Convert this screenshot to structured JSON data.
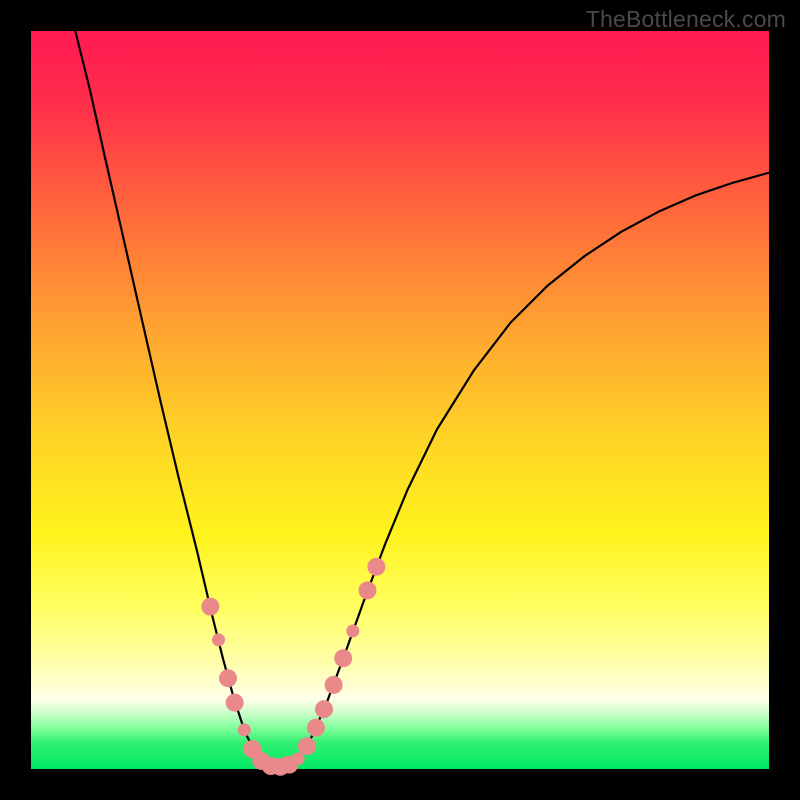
{
  "watermark": "TheBottleneck.com",
  "chart_data": {
    "type": "line",
    "title": "",
    "xlabel": "",
    "ylabel": "",
    "xlim": [
      0,
      100
    ],
    "ylim": [
      0,
      100
    ],
    "gradient": {
      "stops": [
        {
          "pos": 0.0,
          "color": "#ff1a52"
        },
        {
          "pos": 0.1,
          "color": "#ff2e4a"
        },
        {
          "pos": 0.25,
          "color": "#ff6a3a"
        },
        {
          "pos": 0.4,
          "color": "#ffa231"
        },
        {
          "pos": 0.55,
          "color": "#ffd326"
        },
        {
          "pos": 0.68,
          "color": "#fff31c"
        },
        {
          "pos": 0.78,
          "color": "#ffff60"
        },
        {
          "pos": 0.86,
          "color": "#ffffb0"
        },
        {
          "pos": 0.905,
          "color": "#ffffe8"
        },
        {
          "pos": 0.925,
          "color": "#c8ffc8"
        },
        {
          "pos": 0.945,
          "color": "#80ff9a"
        },
        {
          "pos": 0.965,
          "color": "#30f070"
        },
        {
          "pos": 1.0,
          "color": "#00e865"
        }
      ]
    },
    "series": [
      {
        "name": "bottleneck-curve",
        "color": "#000000",
        "width": 2.2,
        "points": [
          {
            "x": 6.0,
            "y": 100.0
          },
          {
            "x": 8.0,
            "y": 92.0
          },
          {
            "x": 10.0,
            "y": 83.0
          },
          {
            "x": 12.5,
            "y": 72.0
          },
          {
            "x": 15.0,
            "y": 61.0
          },
          {
            "x": 17.5,
            "y": 50.0
          },
          {
            "x": 20.0,
            "y": 39.5
          },
          {
            "x": 22.5,
            "y": 29.5
          },
          {
            "x": 24.5,
            "y": 21.0
          },
          {
            "x": 26.0,
            "y": 15.0
          },
          {
            "x": 27.5,
            "y": 9.5
          },
          {
            "x": 29.0,
            "y": 5.0
          },
          {
            "x": 30.5,
            "y": 2.0
          },
          {
            "x": 32.0,
            "y": 0.6
          },
          {
            "x": 33.5,
            "y": 0.2
          },
          {
            "x": 35.0,
            "y": 0.5
          },
          {
            "x": 36.5,
            "y": 1.8
          },
          {
            "x": 38.0,
            "y": 4.3
          },
          {
            "x": 40.0,
            "y": 8.8
          },
          {
            "x": 42.5,
            "y": 15.5
          },
          {
            "x": 45.0,
            "y": 22.5
          },
          {
            "x": 48.0,
            "y": 30.5
          },
          {
            "x": 51.0,
            "y": 37.8
          },
          {
            "x": 55.0,
            "y": 46.0
          },
          {
            "x": 60.0,
            "y": 54.0
          },
          {
            "x": 65.0,
            "y": 60.5
          },
          {
            "x": 70.0,
            "y": 65.5
          },
          {
            "x": 75.0,
            "y": 69.5
          },
          {
            "x": 80.0,
            "y": 72.8
          },
          {
            "x": 85.0,
            "y": 75.5
          },
          {
            "x": 90.0,
            "y": 77.7
          },
          {
            "x": 95.0,
            "y": 79.4
          },
          {
            "x": 100.0,
            "y": 80.8
          }
        ]
      }
    ],
    "markers": {
      "color": "#e98989",
      "radius_small": 6.5,
      "radius_large": 9.0,
      "points": [
        {
          "x": 24.3,
          "y": 22.0,
          "r": "large"
        },
        {
          "x": 25.4,
          "y": 17.5,
          "r": "small"
        },
        {
          "x": 26.7,
          "y": 12.3,
          "r": "large"
        },
        {
          "x": 27.6,
          "y": 9.0,
          "r": "large"
        },
        {
          "x": 28.9,
          "y": 5.3,
          "r": "small"
        },
        {
          "x": 30.0,
          "y": 2.7,
          "r": "large"
        },
        {
          "x": 31.2,
          "y": 1.1,
          "r": "large"
        },
        {
          "x": 32.5,
          "y": 0.4,
          "r": "large"
        },
        {
          "x": 33.8,
          "y": 0.3,
          "r": "large"
        },
        {
          "x": 35.0,
          "y": 0.6,
          "r": "large"
        },
        {
          "x": 36.2,
          "y": 1.4,
          "r": "small"
        },
        {
          "x": 37.4,
          "y": 3.1,
          "r": "large"
        },
        {
          "x": 38.6,
          "y": 5.6,
          "r": "large"
        },
        {
          "x": 39.7,
          "y": 8.1,
          "r": "large"
        },
        {
          "x": 41.0,
          "y": 11.4,
          "r": "large"
        },
        {
          "x": 42.3,
          "y": 15.0,
          "r": "large"
        },
        {
          "x": 43.6,
          "y": 18.7,
          "r": "small"
        },
        {
          "x": 45.6,
          "y": 24.2,
          "r": "large"
        },
        {
          "x": 46.8,
          "y": 27.4,
          "r": "large"
        }
      ]
    }
  }
}
